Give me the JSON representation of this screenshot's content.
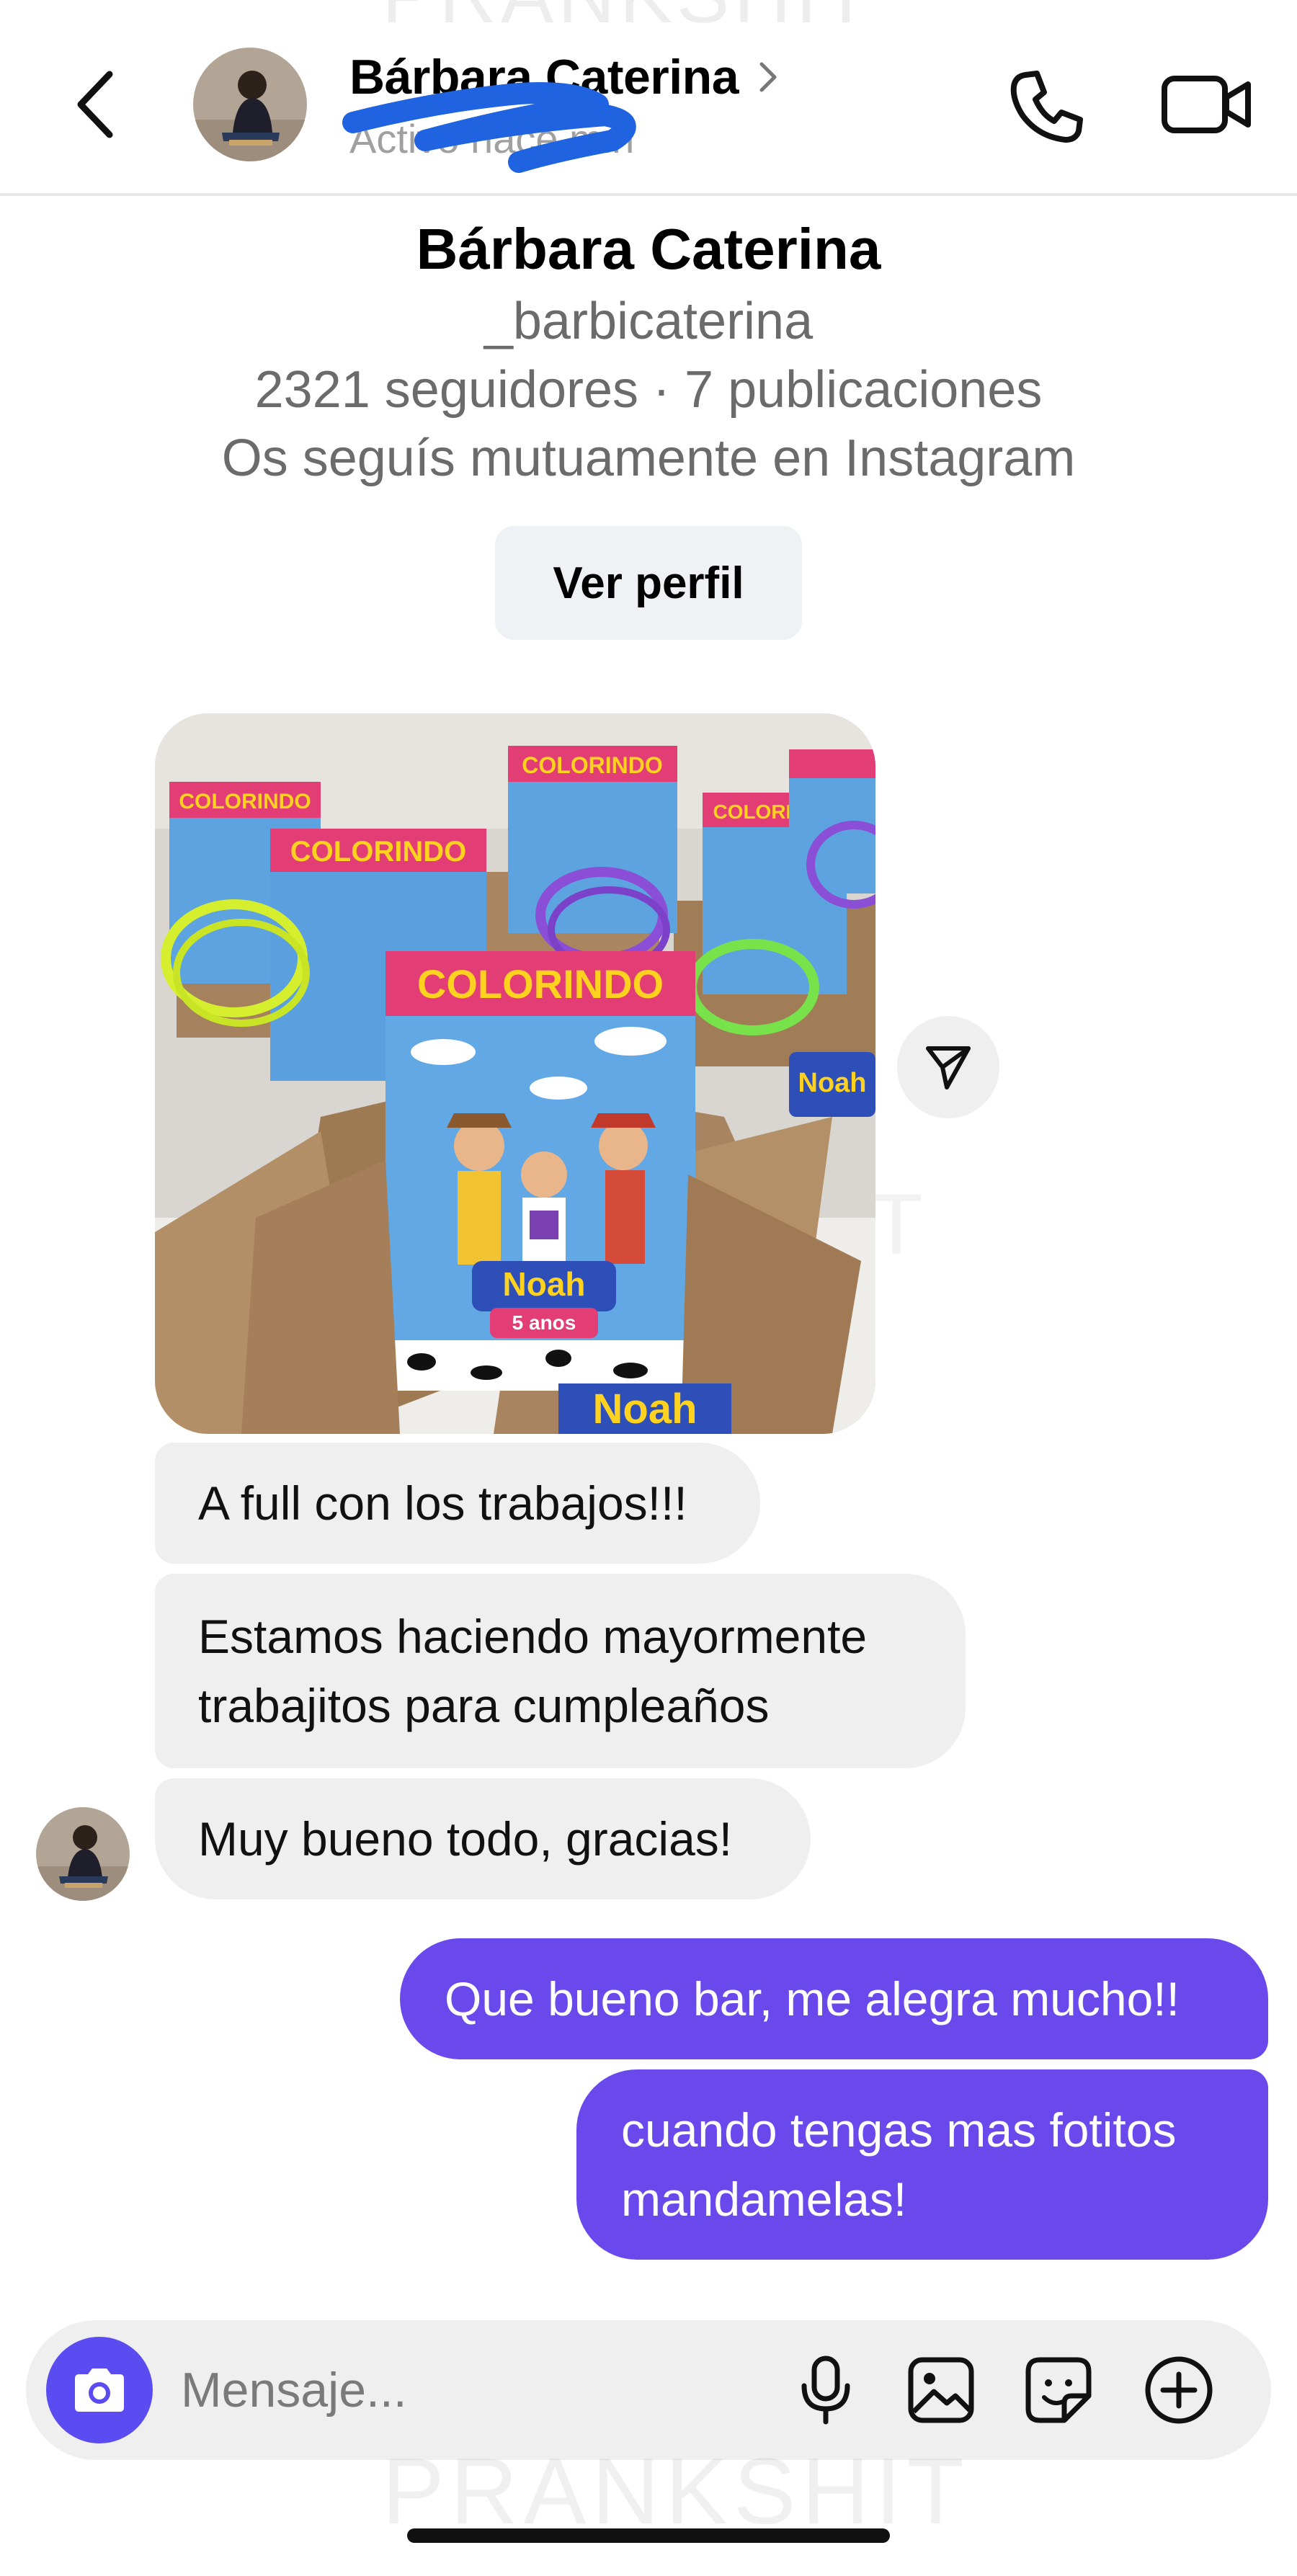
{
  "header": {
    "contact_name": "Bárbara Caterina",
    "status": "Activo hace   min",
    "back_label": "Atrás"
  },
  "profile": {
    "name": "Bárbara Caterina",
    "handle": "_barbicaterina",
    "stats": "2321 seguidores · 7 publicaciones",
    "mutual": "Os seguís mutuamente en Instagram",
    "view_profile_label": "Ver perfil"
  },
  "messages": {
    "incoming": [
      "A full con los trabajos!!!",
      "Estamos haciendo mayormente trabajitos para cumpleaños",
      "Muy bueno todo, gracias!"
    ],
    "outgoing": [
      "Que bueno bar, me alegra mucho!!",
      "cuando tengas mas fotitos mandamelas!"
    ],
    "photo_text": {
      "brand": "COLORINDO",
      "kid_name": "Noah",
      "kid_age": "5 anos"
    }
  },
  "composer": {
    "placeholder": "Mensaje..."
  },
  "watermark": "PRANKSHIT",
  "icons": [
    "back-arrow-icon",
    "chevron-right-icon",
    "phone-icon",
    "video-camera-icon",
    "send-icon",
    "camera-icon",
    "microphone-icon",
    "gallery-icon",
    "sticker-icon",
    "plus-icon"
  ],
  "colors": {
    "outgoing_bubble": "#6a49ec",
    "incoming_bubble": "#efefef",
    "camera_button": "#5b4cf1",
    "secondary_text": "#6b6b6b",
    "scribble": "#1f63e0"
  }
}
